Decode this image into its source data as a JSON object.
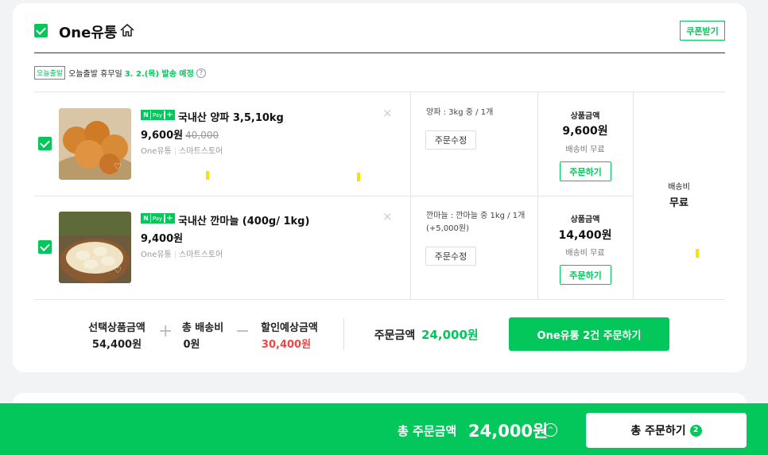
{
  "store": {
    "name": "One유통",
    "coupon_label": "쿠폰받기",
    "ship_badge": "오늘출발",
    "ship_notice": "오늘출발 휴무일",
    "ship_date": "3. 2.(목) 발송 예정",
    "help_glyph": "?"
  },
  "items": [
    {
      "npay_n": "N",
      "npay_pay": "Pay",
      "npay_plus": "+",
      "name": "국내산 양파 3,5,10kg",
      "price": "9,600원",
      "original_price": "40,000",
      "seller": "One유통",
      "channel": "스마트스토어",
      "option": "양파 : 3kg 중 / 1개",
      "edit_label": "주문수정",
      "amount_label": "상품금액",
      "amount": "9,600원",
      "shipping": "배송비 무료",
      "order_label": "주문하기",
      "close_glyph": "×"
    },
    {
      "npay_n": "N",
      "npay_pay": "Pay",
      "npay_plus": "+",
      "name": "국내산 깐마늘 (400g/ 1kg)",
      "price": "9,400원",
      "seller": "One유통",
      "channel": "스마트스토어",
      "option": "깐마늘 : 깐마늘 중 1kg / 1개 (+5,000원)",
      "edit_label": "주문수정",
      "amount_label": "상품금액",
      "amount": "14,400원",
      "shipping": "배송비 무료",
      "order_label": "주문하기",
      "close_glyph": "×"
    }
  ],
  "delivery_fee": {
    "label": "배송비",
    "value": "무료"
  },
  "summary": {
    "selected_label": "선택상품금액",
    "selected_value": "54,400원",
    "plus_glyph": "+",
    "shipping_label": "총 배송비",
    "shipping_value": "0원",
    "minus_glyph": "−",
    "discount_label": "할인예상금액",
    "discount_value": "30,400원",
    "order_amount_label": "주문금액",
    "order_amount_value": "24,000원",
    "order_button": "One유통  2건 주문하기"
  },
  "bottom": {
    "total_label": "총 주문금액",
    "total_value": "24,000원",
    "chevron_glyph": "^",
    "order_all_label": "총 주문하기",
    "count": "2"
  },
  "colors": {
    "accent": "#03c75a",
    "discount": "#f04646",
    "highlight_mark": "#f5e400"
  }
}
